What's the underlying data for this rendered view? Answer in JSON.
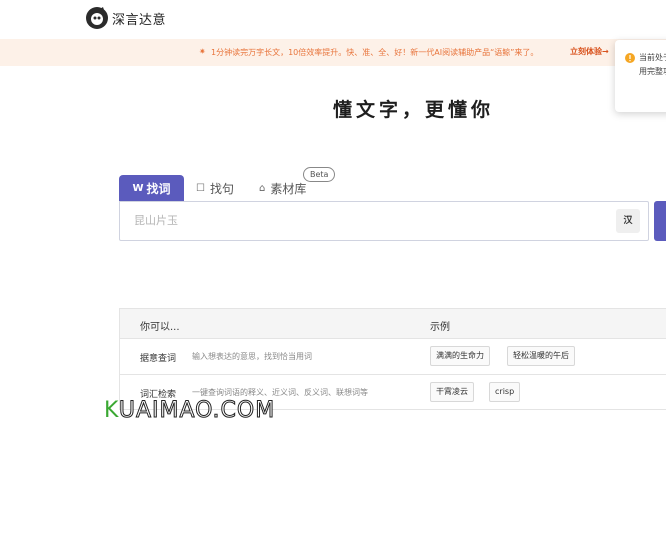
{
  "brand": {
    "name": "深言达意"
  },
  "banner": {
    "text": "1分钟读完万字长文，10倍效率提升。快、准、全、好！新一代AI阅读辅助产品“语鲸”来了。",
    "cta": "立刻体验→"
  },
  "toast": {
    "line1": "当前处于",
    "line2": "用完整功"
  },
  "slogan": "懂文字，更懂你",
  "tabs": [
    {
      "label": "找词",
      "icon": "W"
    },
    {
      "label": "找句",
      "icon": "☐"
    },
    {
      "label": "素材库",
      "icon": "⌂"
    }
  ],
  "beta_badge": "Beta",
  "search": {
    "placeholder": "昆山片玉",
    "value": ""
  },
  "ime_button": "汉",
  "hints": {
    "header_left": "你可以...",
    "header_right": "示例",
    "rows": [
      {
        "title": "据意查词",
        "desc": "输入想表达的意思，找到恰当用词",
        "examples": [
          "满满的生命力",
          "轻松温暖的午后"
        ]
      },
      {
        "title": "词汇检索",
        "desc": "一键查询词语的释义、近义词、反义词、联想词等",
        "examples": [
          "干霄凌云",
          "crisp"
        ]
      }
    ]
  },
  "watermark": {
    "first": "K",
    "rest": "UAIMAO.COM"
  },
  "colors": {
    "accent": "#5b5bbd",
    "banner_bg": "#fdf1e8",
    "banner_text": "#e8743b"
  }
}
